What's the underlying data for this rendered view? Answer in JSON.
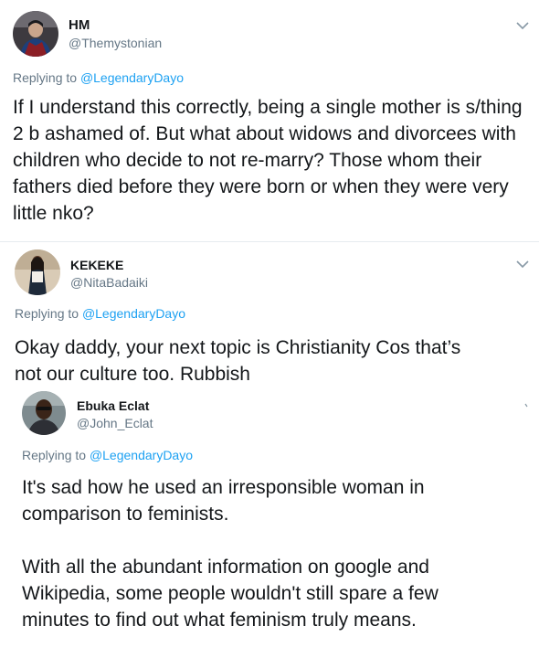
{
  "tweets": [
    {
      "name": "HM",
      "handle": "@Themystonian",
      "replying_prefix": "Replying to",
      "replying_to": "@LegendaryDayo",
      "text": "If I understand this correctly, being a single mother is s/thing 2 b ashamed of. But what about widows and divorcees with children who decide to not re-marry? Those whom their fathers died before they were born or when they were very little nko?"
    },
    {
      "name": "KEKEKE",
      "handle": "@NitaBadaiki",
      "replying_prefix": "Replying to",
      "replying_to": "@LegendaryDayo",
      "text": "Okay daddy, your next topic is Christianity Cos that’s not our culture too. Rubbish"
    },
    {
      "name": "Ebuka Eclat",
      "handle": "@John_Eclat",
      "replying_prefix": "Replying to",
      "replying_to": "@LegendaryDayo",
      "paragraphs": [
        "It's sad how he used an irresponsible woman in comparison to feminists.",
        "With all the abundant information on google and Wikipedia, some people wouldn't still spare a few minutes to find out what feminism truly means."
      ]
    }
  ],
  "icons": {
    "more": "chevron-down-icon"
  },
  "colors": {
    "link": "#1da1f2",
    "secondary_text": "#657786",
    "primary_text": "#14171a",
    "divider": "#e6ecf0"
  }
}
